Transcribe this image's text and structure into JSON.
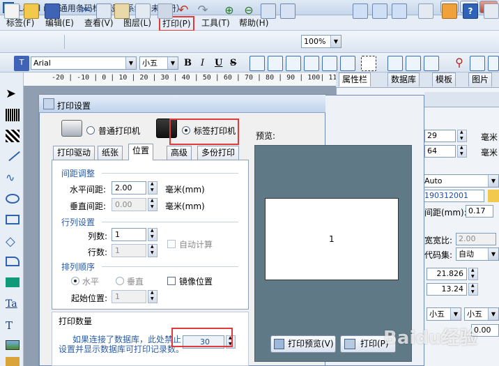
{
  "app": {
    "title": "Label mx 通用条码标签设计系统（未注册）"
  },
  "window_buttons": {
    "minimize": "—",
    "maximize": "□",
    "close": "✕"
  },
  "menu": [
    "标签(F)",
    "编辑(E)",
    "查看(V)",
    "图层(L)",
    "打印(P)",
    "工具(T)",
    "帮助(H)"
  ],
  "toolbar": {
    "zoom": "100%"
  },
  "toolbar2": {
    "font": "Arial",
    "font_size": "小五",
    "bold": "B",
    "italic": "I",
    "underline": "U",
    "strike": "S"
  },
  "ruler": "-20 | -10 | 0  | 10 | 20 | 30 | 40 | 50 | 60 | 70 | 80 | 90 | 100| 110",
  "right_tabs": [
    "属性栏",
    "数据库",
    "模板",
    "图片"
  ],
  "dialog": {
    "title": "打印设置",
    "printer_types": [
      "普通打印机",
      "标签打印机"
    ],
    "tabs": [
      "打印驱动",
      "纸张",
      "位置",
      "高级",
      "多份打印"
    ],
    "spacing": {
      "section": "间距调整",
      "h_label": "水平间距:",
      "h_value": "2.00",
      "v_label": "垂直间距:",
      "v_value": "0.00",
      "unit": "毫米(mm)"
    },
    "rowcol": {
      "section": "行列设置",
      "cols_label": "列数:",
      "cols_value": "1",
      "rows_label": "行数:",
      "rows_value": "1",
      "auto_calc": "自动计算"
    },
    "order": {
      "section": "排列顺序",
      "horizontal": "水平",
      "vertical": "垂直",
      "mirror": "镜像位置",
      "start_label": "起始位置:",
      "start_value": "1"
    },
    "print_count": {
      "section": "打印数量",
      "note_line1": "如果连接了数据库，此处禁止",
      "note_line2": "设置并显示数据库可打印记录数。",
      "value": "30"
    },
    "preview": {
      "label": "预览:",
      "page_number": "1"
    },
    "buttons": {
      "preview": "打印预览(V)",
      "print": "打印(P)"
    }
  },
  "right_panel": {
    "val1": "29",
    "val2": "64",
    "unit": "毫米",
    "auto": "Auto",
    "code": "190312001",
    "spacing_label": "间距(mm):",
    "spacing_value": "0.17",
    "ratio_label": "宽宽比:",
    "ratio_value": "2.00",
    "charset_label": "代码集:",
    "charset_value": "自动",
    "x": "21.826",
    "y": "13.24",
    "size": "小五",
    "last_value": "0.00"
  },
  "watermark": "Baidu经验"
}
